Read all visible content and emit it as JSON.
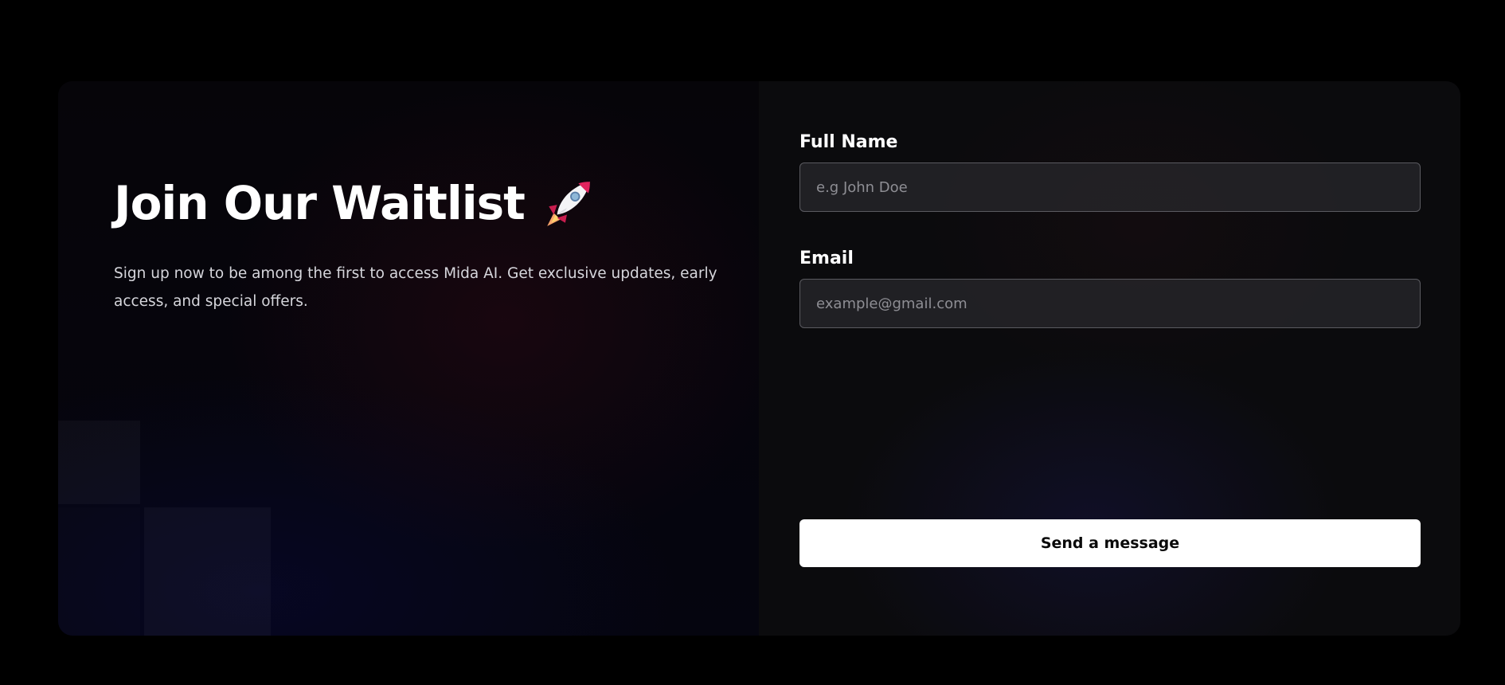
{
  "waitlist": {
    "title": "Join Our Waitlist",
    "title_icon": "rocket-icon",
    "description": "Sign up now to be among the first to access Mida AI. Get exclusive updates, early access, and special offers."
  },
  "form": {
    "full_name": {
      "label": "Full Name",
      "placeholder": "e.g John Doe",
      "value": ""
    },
    "email": {
      "label": "Email",
      "placeholder": "example@gmail.com",
      "value": ""
    },
    "submit_label": "Send a message"
  },
  "colors": {
    "background": "#000000",
    "panel_right": "#0b0b0d",
    "button_bg": "#ffffff",
    "button_text": "#0a0a0a",
    "rocket_body": "#e0245e",
    "rocket_window": "#8fb8d8"
  }
}
